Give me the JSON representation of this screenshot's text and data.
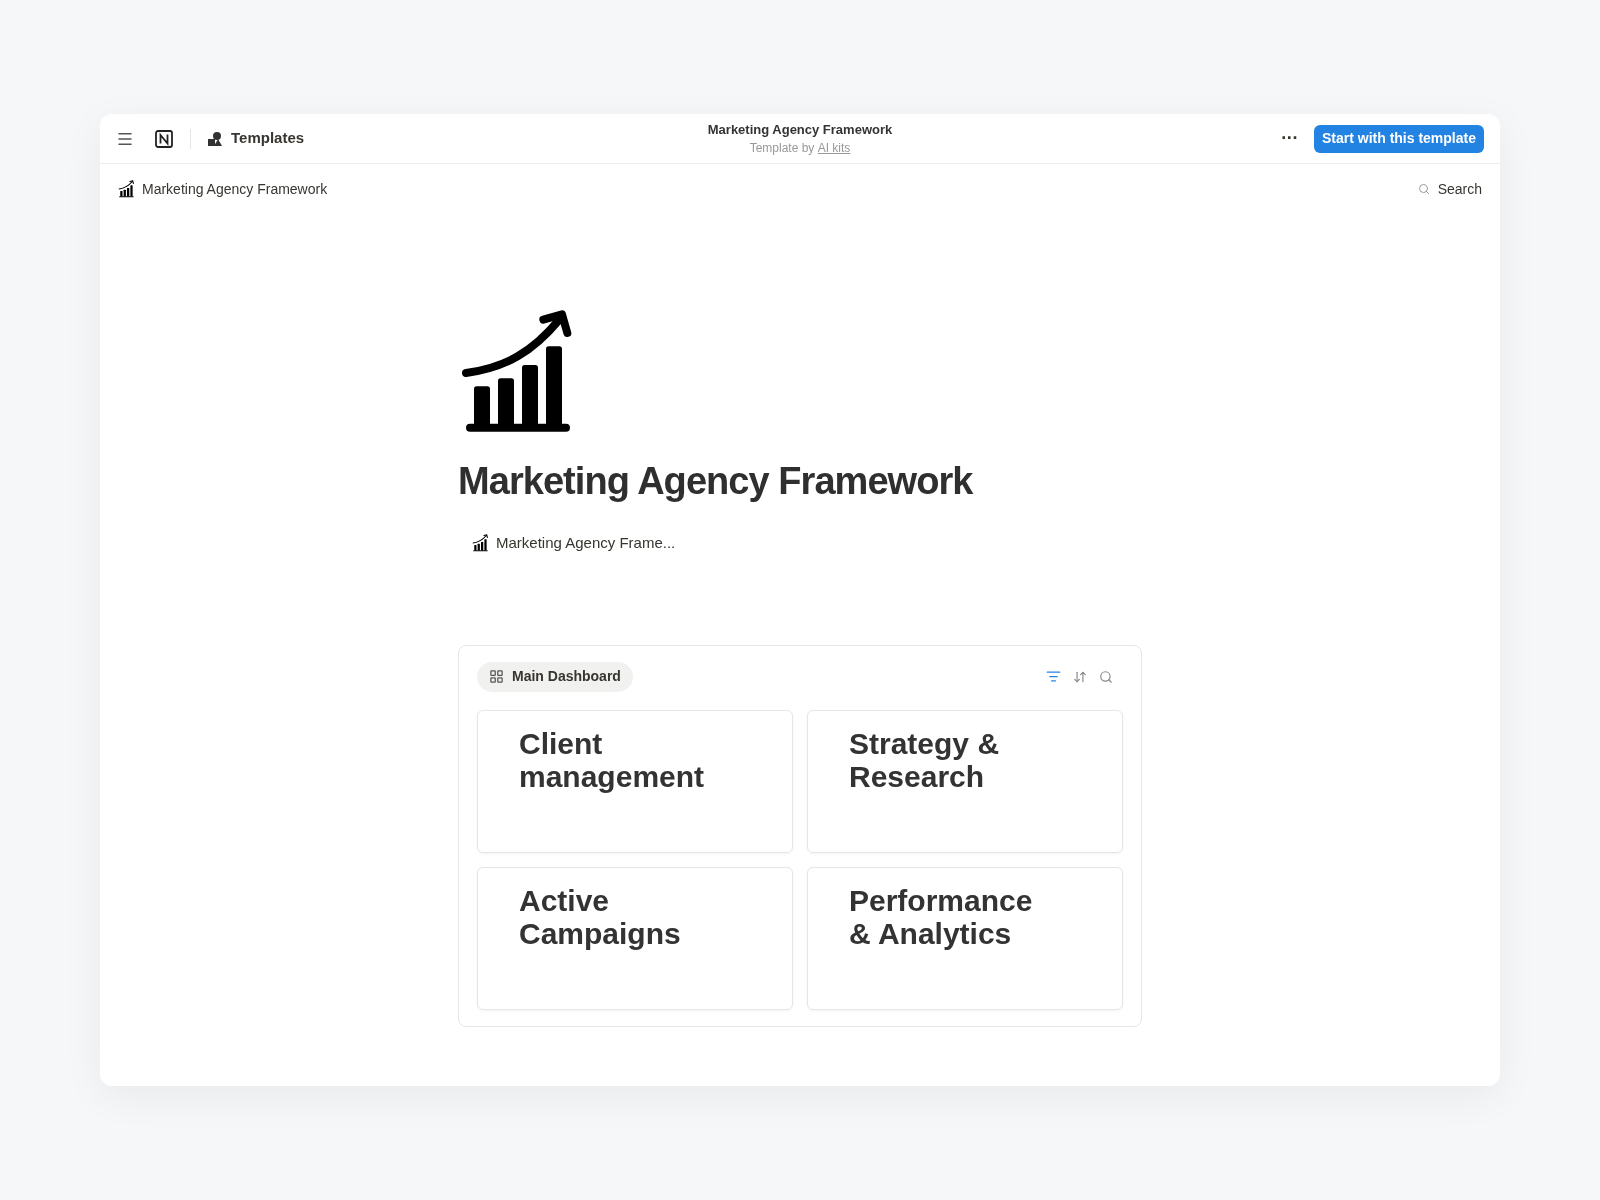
{
  "header": {
    "app": "Templates",
    "title": "Marketing Agency Framework",
    "byline": "Template by ",
    "author": "AI kits",
    "more": "···",
    "cta": "Start with this template"
  },
  "breadcrumb": {
    "page": "Marketing Agency Framework",
    "search": "Search"
  },
  "page": {
    "title": "Marketing Agency Framework",
    "link": "Marketing Agency Frame..."
  },
  "dashboard": {
    "view": "Main Dashboard",
    "filter_active": true,
    "cards": [
      {
        "title": "Client management"
      },
      {
        "title": "Strategy & Research"
      },
      {
        "title": "Active Campaigns"
      },
      {
        "title": "Performance & Analytics"
      }
    ]
  }
}
